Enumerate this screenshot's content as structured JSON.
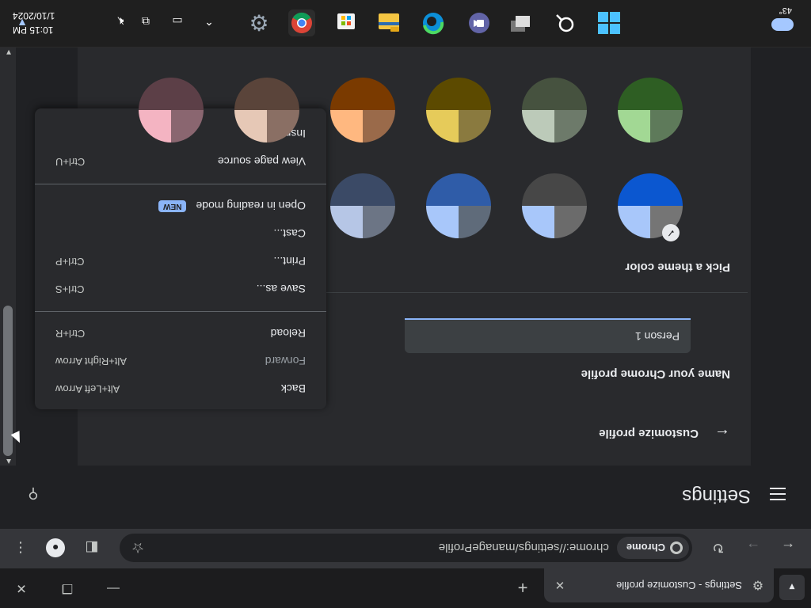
{
  "browser": {
    "tab": {
      "title": "Settings - Customize profile",
      "close": "✕"
    },
    "new_tab": "+",
    "window_controls": {
      "minimize": "—",
      "restore": "❐",
      "close": "✕"
    },
    "omnibox": {
      "chip_label": "Chrome",
      "url": "chrome://settings/manageProfile"
    }
  },
  "settings": {
    "header_title": "Settings",
    "page_title": "Customize profile",
    "name_label": "Name your Chrome profile",
    "name_value": "Person 1",
    "theme_label": "Pick a theme color",
    "themes_row1": [
      {
        "tl": "#a8c7fa",
        "tr": "#757575",
        "b": "#0b57d0",
        "selected": true
      },
      {
        "tl": "#a8c7fa",
        "tr": "#6b6b6b",
        "b": "#474747"
      },
      {
        "tl": "#a8c7fa",
        "tr": "#5f6b7a",
        "b": "#2f5ca8"
      },
      {
        "tl": "#b6c6e6",
        "tr": "#6c7585",
        "b": "#3b4a66"
      }
    ],
    "themes_row2": [
      {
        "tl": "#a2d894",
        "tr": "#5e7a5a",
        "b": "#2e5e23"
      },
      {
        "tl": "#bccab9",
        "tr": "#6d7a6a",
        "b": "#46523f"
      },
      {
        "tl": "#e6cb5a",
        "tr": "#8a7a3f",
        "b": "#5c4a00"
      },
      {
        "tl": "#ffb880",
        "tr": "#9a6a4a",
        "b": "#7a3a00"
      },
      {
        "tl": "#e6c8b6",
        "tr": "#8a6f64",
        "b": "#5a443a"
      },
      {
        "tl": "#f4b4c2",
        "tr": "#8a6670",
        "b": "#5c3f47"
      }
    ]
  },
  "context_menu": {
    "items": [
      {
        "label": "Back",
        "shortcut": "Alt+Left Arrow"
      },
      {
        "label": "Forward",
        "shortcut": "Alt+Right Arrow"
      },
      {
        "label": "Reload",
        "shortcut": "Ctrl+R"
      },
      {
        "label": "Save as...",
        "shortcut": "Ctrl+S"
      },
      {
        "label": "Print...",
        "shortcut": "Ctrl+P"
      },
      {
        "label": "Cast...",
        "shortcut": ""
      },
      {
        "label": "Open in reading mode",
        "badge": "NEW"
      },
      {
        "label": "View page source",
        "shortcut": "Ctrl+U"
      },
      {
        "label": "Inspect",
        "shortcut": ""
      }
    ]
  },
  "taskbar": {
    "weather_temp": "43°",
    "clock_time": "10:15 PM",
    "clock_date": "1/10/2024",
    "colors": {
      "chrome_red": "#db4437",
      "chrome_yellow": "#f4b400",
      "chrome_green": "#0f9d58",
      "edge_blue": "#0c8fd8",
      "teams_purple": "#6264a7"
    }
  }
}
